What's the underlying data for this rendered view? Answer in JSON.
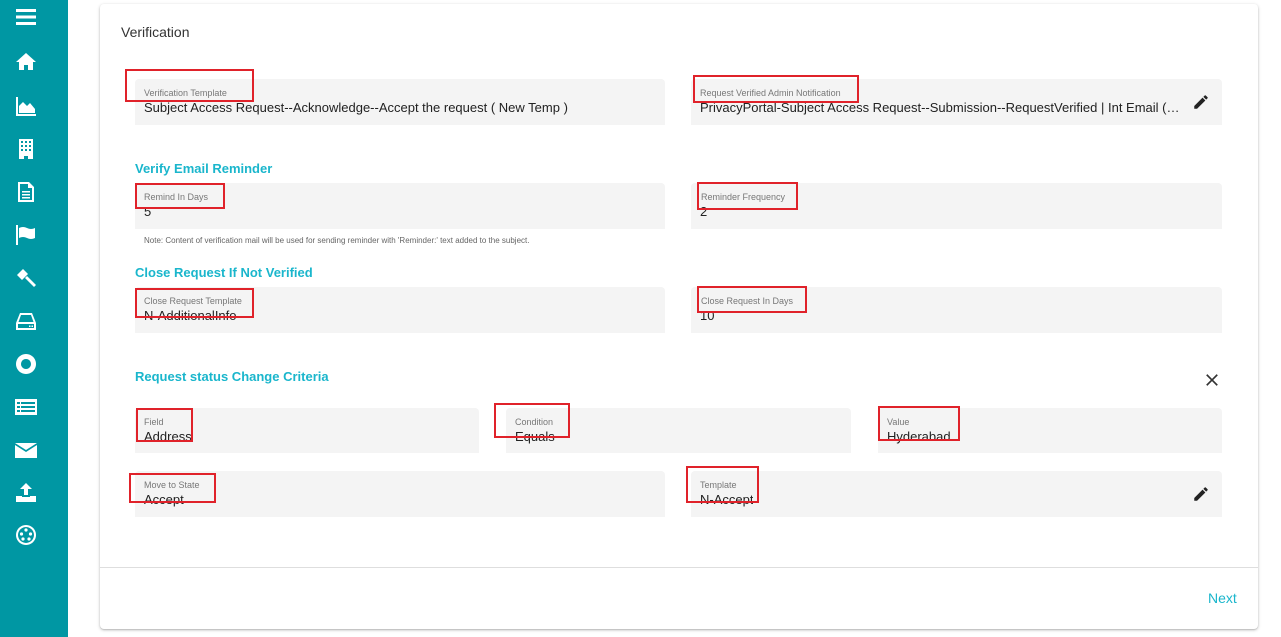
{
  "sidebar": {
    "items": [
      {
        "icon": "menu-icon"
      },
      {
        "icon": "home-icon"
      },
      {
        "icon": "area-chart-icon"
      },
      {
        "icon": "building-icon"
      },
      {
        "icon": "document-icon"
      },
      {
        "icon": "flag-icon"
      },
      {
        "icon": "gavel-icon"
      },
      {
        "icon": "hard-drive-icon"
      },
      {
        "icon": "lifebuoy-icon"
      },
      {
        "icon": "list-icon"
      },
      {
        "icon": "envelope-icon"
      },
      {
        "icon": "upload-icon"
      },
      {
        "icon": "network-icon"
      }
    ],
    "color": "#0097a3"
  },
  "page": {
    "title": "Verification",
    "verification_template": {
      "label": "Verification Template",
      "value": "Subject Access Request--Acknowledge--Accept the request ( New Temp )"
    },
    "admin_notification": {
      "label": "Request Verified Admin Notification",
      "value": "PrivacyPortal-Subject Access Request--Submission--RequestVerified | Int Email ( A..."
    },
    "reminder_section": {
      "title": "Verify Email Reminder",
      "remind_in_days": {
        "label": "Remind In Days",
        "value": "5"
      },
      "reminder_frequency": {
        "label": "Reminder Frequency",
        "value": "2"
      },
      "note": "Note: Content of verification mail will be used for sending reminder with 'Reminder:' text added to the subject."
    },
    "close_section": {
      "title": "Close Request If Not Verified",
      "close_template": {
        "label": "Close Request Template",
        "value": "N-AdditionalInfo"
      },
      "close_in_days": {
        "label": "Close Request In Days",
        "value": "10"
      }
    },
    "criteria_section": {
      "title": "Request status Change Criteria",
      "field": {
        "label": "Field",
        "value": "Address"
      },
      "condition": {
        "label": "Condition",
        "value": "Equals"
      },
      "value": {
        "label": "Value",
        "value": "Hyderabad"
      },
      "move_to_state": {
        "label": "Move to State",
        "value": "Accept"
      },
      "template": {
        "label": "Template",
        "value": "N-Accept"
      }
    },
    "next_label": "Next",
    "accent_color": "#1ab6cc"
  }
}
